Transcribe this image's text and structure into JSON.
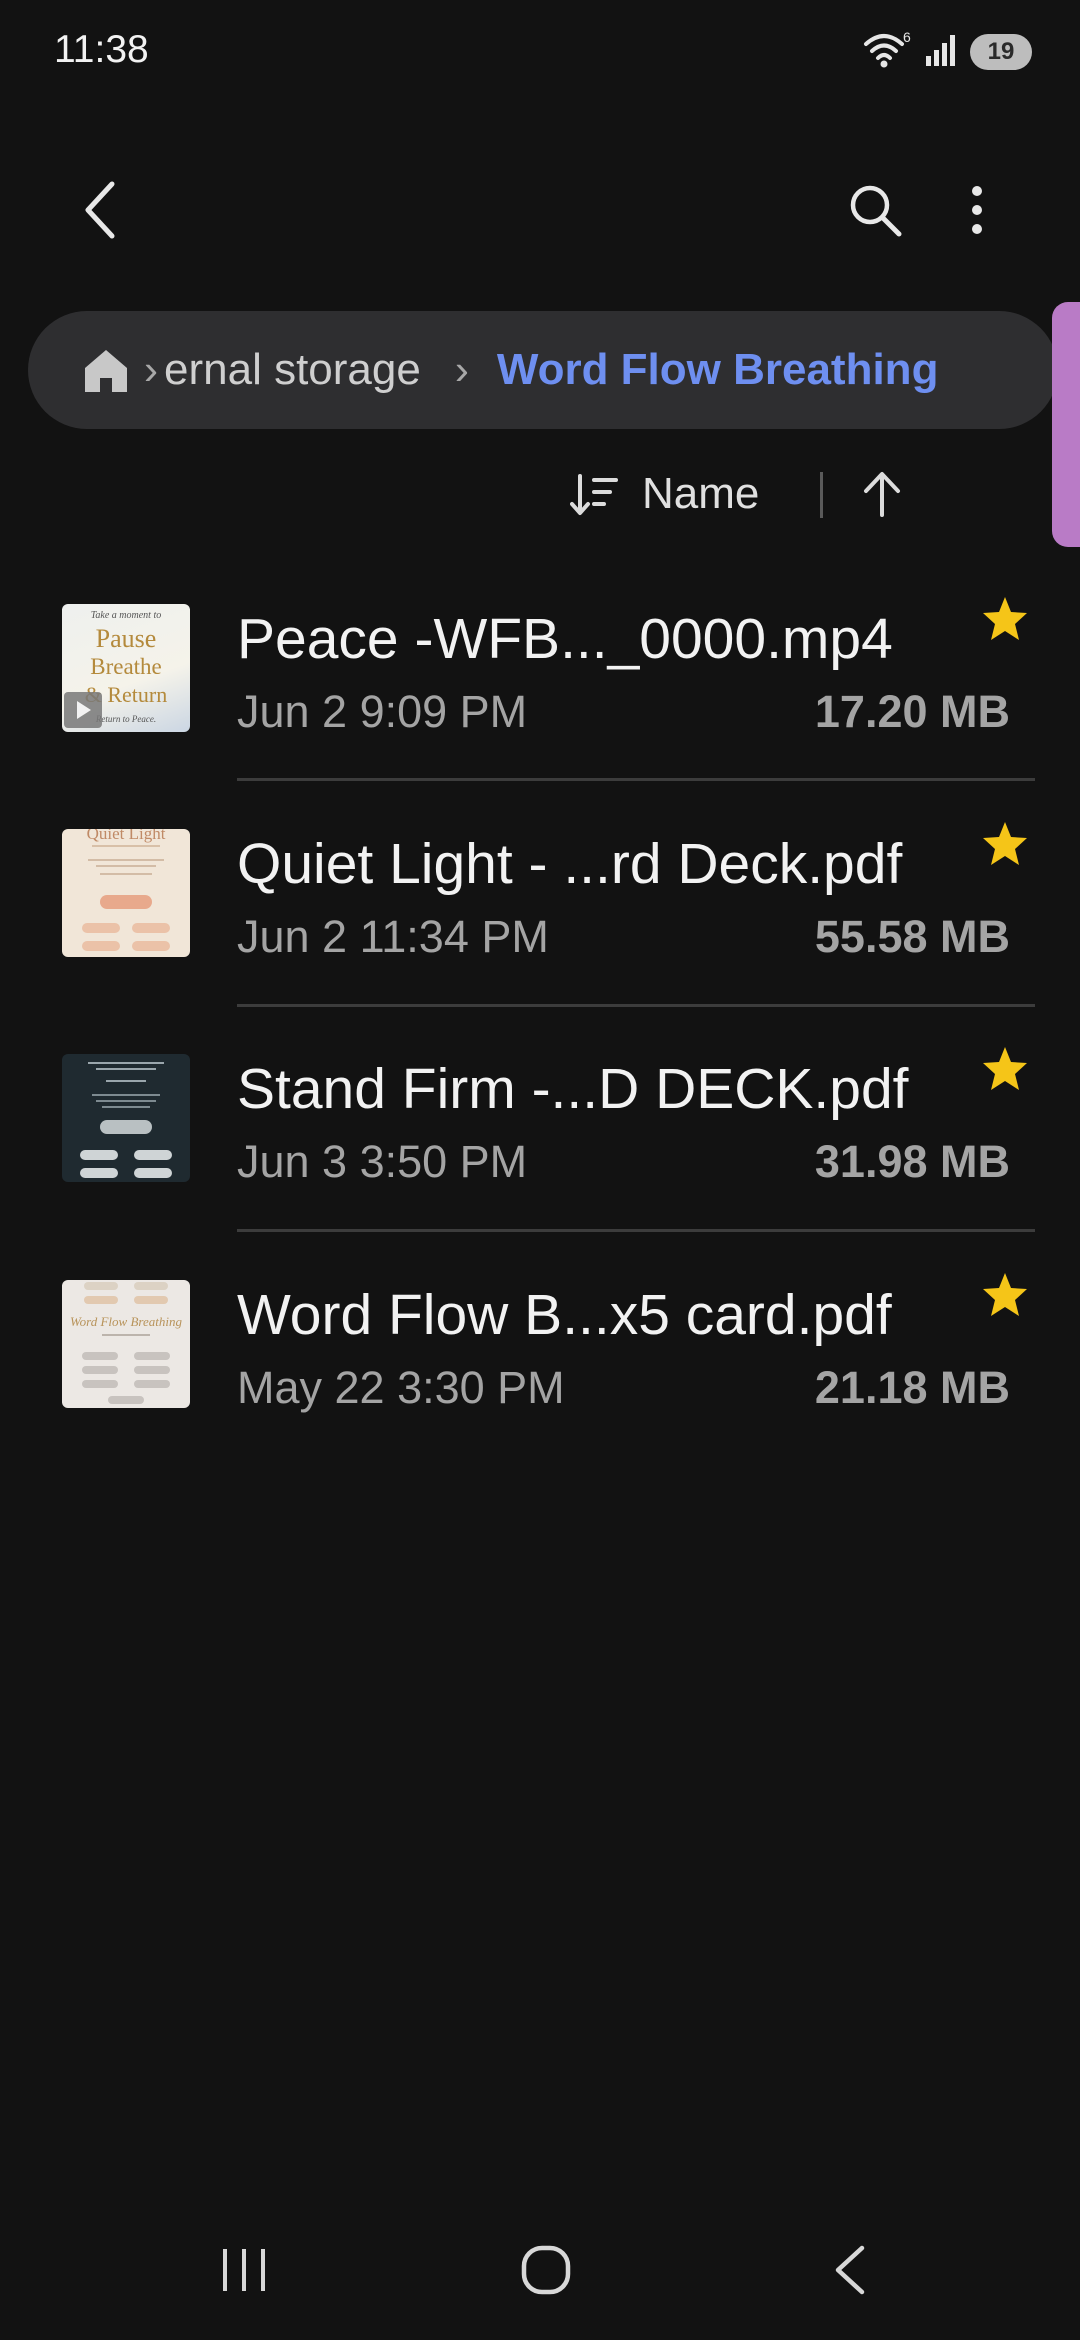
{
  "status_bar": {
    "time": "11:38",
    "wifi_badge": "6",
    "battery": "19"
  },
  "app_bar": {
    "back_icon": "back-arrow-icon",
    "search_icon": "search-icon",
    "more_icon": "more-vert-icon"
  },
  "breadcrumb": {
    "home_icon": "home-icon",
    "path": [
      "ernal storage"
    ],
    "current": "Word Flow Breathing"
  },
  "sort": {
    "label": "Name",
    "direction": "ascending"
  },
  "files": [
    {
      "name": "Peace -WFB..._0000.mp4",
      "date": "Jun 2 9:09 PM",
      "size": "17.20 MB",
      "favorite": true,
      "type": "video"
    },
    {
      "name": "Quiet Light - ...rd Deck.pdf",
      "date": "Jun 2 11:34 PM",
      "size": "55.58 MB",
      "favorite": true,
      "type": "pdf"
    },
    {
      "name": "Stand Firm -...D DECK.pdf",
      "date": "Jun 3 3:50 PM",
      "size": "31.98 MB",
      "favorite": true,
      "type": "pdf"
    },
    {
      "name": "Word Flow B...x5 card.pdf",
      "date": "May 22 3:30 PM",
      "size": "21.18 MB",
      "favorite": true,
      "type": "pdf"
    }
  ],
  "thumbnails": {
    "t1": [
      "Take a moment to",
      "Pause",
      "Breathe",
      "& Return",
      "Return to Peace."
    ],
    "t2": [
      "Quiet Light"
    ],
    "t4": [
      "Word Flow Breathing"
    ]
  },
  "colors": {
    "background": "#121212",
    "accent": "#6e8ff0",
    "star": "#f5c518",
    "edge_tab": "#b97bc6"
  },
  "nav_bar": {
    "recents_icon": "recents-icon",
    "home_icon": "home-circle-icon",
    "back_icon": "nav-back-icon"
  }
}
